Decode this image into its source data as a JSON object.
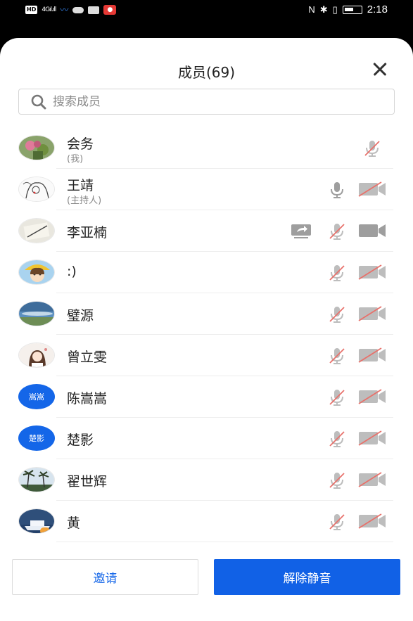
{
  "status_bar": {
    "hd": "HD",
    "network": "4G",
    "signal": "ıl.ıll",
    "nfc": "N",
    "bluetooth": "✱",
    "vibrate": "▯",
    "time": "2:18"
  },
  "sheet": {
    "title": "成员(69)",
    "search_placeholder": "搜索成员"
  },
  "colors": {
    "primary": "#1161e6",
    "muted_red": "#e8716b",
    "icon_grey": "#b8b8b8"
  },
  "members": [
    {
      "name": "会务",
      "subtitle": "(我)",
      "avatar": "photo-flowers",
      "mic": "muted",
      "camera": "none",
      "sharing": false
    },
    {
      "name": "王靖",
      "subtitle": "(主持人)",
      "avatar": "photo-sketch",
      "mic": "on",
      "camera": "off",
      "sharing": false
    },
    {
      "name": "李亚楠",
      "subtitle": "",
      "avatar": "photo-notebook",
      "mic": "muted",
      "camera": "on",
      "sharing": true
    },
    {
      "name": ":)",
      "subtitle": "",
      "avatar": "photo-anime",
      "mic": "muted",
      "camera": "off",
      "sharing": false
    },
    {
      "name": "璧源",
      "subtitle": "",
      "avatar": "photo-sky",
      "mic": "muted",
      "camera": "off",
      "sharing": false
    },
    {
      "name": "曾立雯",
      "subtitle": "",
      "avatar": "photo-girl",
      "mic": "muted",
      "camera": "off",
      "sharing": false
    },
    {
      "name": "陈嵩嵩",
      "subtitle": "",
      "avatar": "text",
      "avatar_text": "嵩嵩",
      "mic": "muted",
      "camera": "off",
      "sharing": false
    },
    {
      "name": "楚影",
      "subtitle": "",
      "avatar": "text",
      "avatar_text": "楚影",
      "mic": "muted",
      "camera": "off",
      "sharing": false
    },
    {
      "name": "翟世辉",
      "subtitle": "",
      "avatar": "photo-palms",
      "mic": "muted",
      "camera": "off",
      "sharing": false
    },
    {
      "name": "黄",
      "subtitle": "",
      "avatar": "photo-ship",
      "mic": "muted",
      "camera": "off",
      "sharing": false
    }
  ],
  "buttons": {
    "invite": "邀请",
    "unmute_all": "解除静音"
  }
}
